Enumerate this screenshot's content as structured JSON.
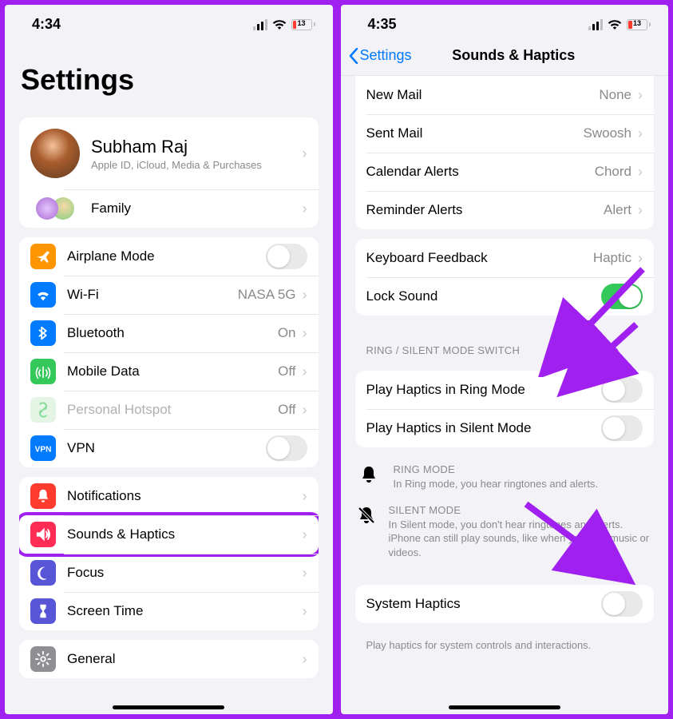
{
  "left": {
    "time": "4:34",
    "battery": "13",
    "title": "Settings",
    "profile": {
      "name": "Subham Raj",
      "sub": "Apple ID, iCloud, Media & Purchases"
    },
    "family": "Family",
    "group1": [
      {
        "label": "Airplane Mode",
        "icon": "airplane",
        "color": "#ff9500",
        "toggle": false
      },
      {
        "label": "Wi-Fi",
        "icon": "wifi",
        "color": "#007aff",
        "value": "NASA 5G"
      },
      {
        "label": "Bluetooth",
        "icon": "bt",
        "color": "#007aff",
        "value": "On"
      },
      {
        "label": "Mobile Data",
        "icon": "ant",
        "color": "#34c759",
        "value": "Off"
      },
      {
        "label": "Personal Hotspot",
        "icon": "link",
        "color": "#d4f0d4",
        "value": "Off",
        "disabled": true
      },
      {
        "label": "VPN",
        "icon": "vpn",
        "color": "#007aff",
        "toggle": false
      }
    ],
    "group2": [
      {
        "label": "Notifications",
        "icon": "bell",
        "color": "#ff3b30"
      },
      {
        "label": "Sounds & Haptics",
        "icon": "speaker",
        "color": "#ff2d55",
        "highlight": true
      },
      {
        "label": "Focus",
        "icon": "moon",
        "color": "#5856d6"
      },
      {
        "label": "Screen Time",
        "icon": "hour",
        "color": "#5856d6"
      }
    ],
    "group3": [
      {
        "label": "General",
        "icon": "gear",
        "color": "#8e8e93"
      }
    ]
  },
  "right": {
    "time": "4:35",
    "battery": "13",
    "back": "Settings",
    "title": "Sounds & Haptics",
    "sounds": [
      {
        "label": "New Mail",
        "value": "None"
      },
      {
        "label": "Sent Mail",
        "value": "Swoosh"
      },
      {
        "label": "Calendar Alerts",
        "value": "Chord"
      },
      {
        "label": "Reminder Alerts",
        "value": "Alert"
      }
    ],
    "kb": {
      "label": "Keyboard Feedback",
      "value": "Haptic"
    },
    "lock": {
      "label": "Lock Sound",
      "on": true
    },
    "sec_header": "Ring / Silent Mode Switch",
    "haptics": [
      {
        "label": "Play Haptics in Ring Mode",
        "on": false
      },
      {
        "label": "Play Haptics in Silent Mode",
        "on": false
      }
    ],
    "ringmode": {
      "title": "Ring Mode",
      "body": "In Ring mode, you hear ringtones and alerts."
    },
    "silentmode": {
      "title": "Silent Mode",
      "body": "In Silent mode, you don't hear ringtones and alerts. iPhone can still play sounds, like when you play music or videos."
    },
    "system": {
      "label": "System Haptics",
      "on": false
    },
    "footnote": "Play haptics for system controls and interactions."
  }
}
